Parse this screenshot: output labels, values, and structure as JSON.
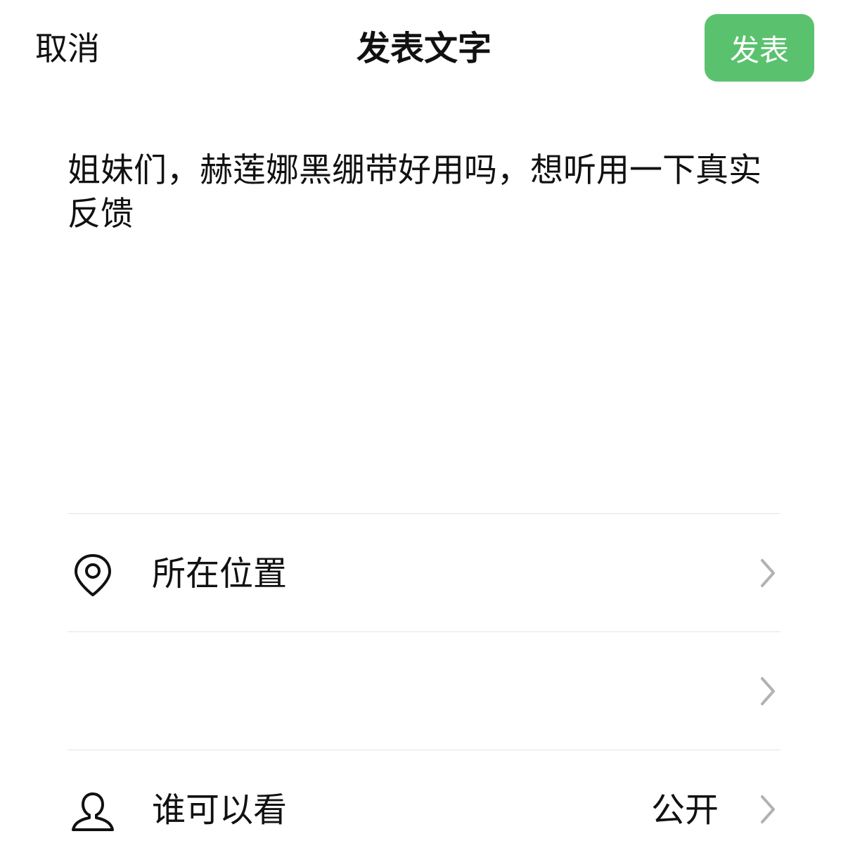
{
  "header": {
    "cancel_label": "取消",
    "title": "发表文字",
    "publish_label": "发表"
  },
  "post": {
    "text": "姐妹们，赫莲娜黑绷带好用吗，想听用一下真实反馈"
  },
  "options": {
    "location": {
      "label": "所在位置",
      "icon": "location-pin-icon"
    },
    "mention": {
      "label": "",
      "icon": ""
    },
    "visibility": {
      "label": "谁可以看",
      "value": "公开",
      "icon": "person-icon"
    }
  },
  "colors": {
    "accent": "#5ac26e",
    "chevron": "#b2b2b2",
    "divider": "#e4e4e4"
  }
}
